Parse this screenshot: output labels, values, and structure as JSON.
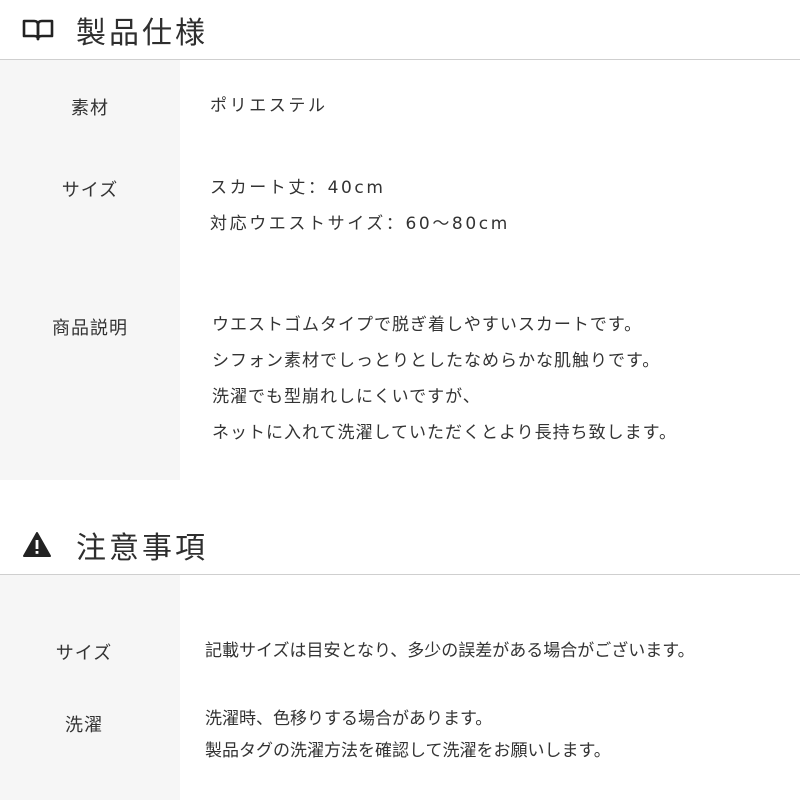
{
  "spec_section": {
    "title": "製品仕様",
    "icon": "open-book-icon",
    "rows": [
      {
        "label": "素材",
        "lines": [
          "ポリエステル"
        ]
      },
      {
        "label": "サイズ",
        "lines": [
          "スカート丈：40cm",
          "対応ウエストサイズ：60～80cm"
        ]
      },
      {
        "label": "商品説明",
        "lines": [
          "ウエストゴムタイプで脱ぎ着しやすいスカートです。",
          "シフォン素材でしっとりとしたなめらかな肌触りです。",
          "洗濯でも型崩れしにくいですが、",
          "ネットに入れて洗濯していただくとより長持ち致します。"
        ]
      }
    ]
  },
  "notice_section": {
    "title": "注意事項",
    "icon": "warning-icon",
    "rows": [
      {
        "label": "サイズ",
        "lines": [
          "記載サイズは目安となり、多少の誤差がある場合がございます。"
        ]
      },
      {
        "label": "洗濯",
        "lines": [
          "洗濯時、色移りする場合があります。",
          "製品タグの洗濯方法を確認して洗濯をお願いします。"
        ]
      }
    ]
  }
}
